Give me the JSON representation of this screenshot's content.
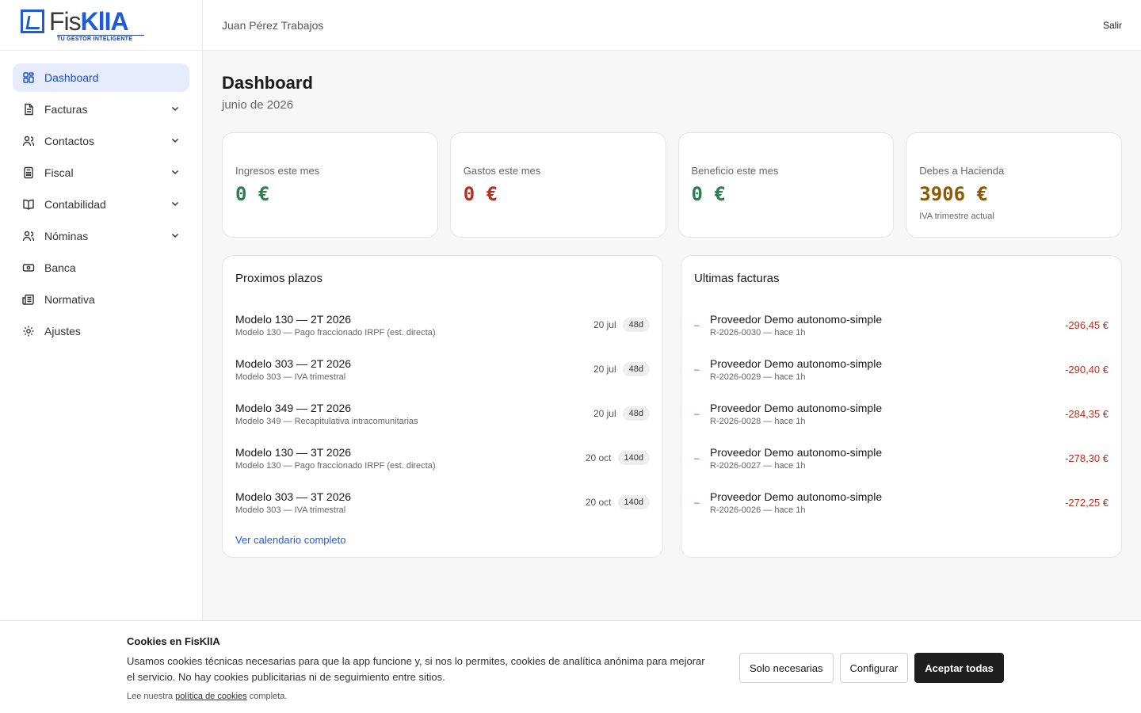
{
  "brand": {
    "logo_fis": "Fis",
    "logo_klia": "KlIA",
    "tagline": "TU GESTOR INTELIGENTE"
  },
  "topbar": {
    "user": "Juan Pérez Trabajos",
    "logout": "Salir"
  },
  "sidebar": {
    "items": [
      {
        "label": "Dashboard",
        "icon": "grid-icon",
        "active": true
      },
      {
        "label": "Facturas",
        "icon": "file-icon",
        "expandable": true
      },
      {
        "label": "Contactos",
        "icon": "users-icon",
        "expandable": true
      },
      {
        "label": "Fiscal",
        "icon": "calculator-icon",
        "expandable": true
      },
      {
        "label": "Contabilidad",
        "icon": "book-icon",
        "expandable": true
      },
      {
        "label": "Nóminas",
        "icon": "users-icon",
        "expandable": true
      },
      {
        "label": "Banca",
        "icon": "banknote-icon"
      },
      {
        "label": "Normativa",
        "icon": "newspaper-icon"
      },
      {
        "label": "Ajustes",
        "icon": "gear-icon"
      }
    ]
  },
  "page": {
    "title": "Dashboard",
    "subtitle": "junio de 2026"
  },
  "kpis": [
    {
      "label": "Ingresos este mes",
      "value": "0 €",
      "color": "#2e7d4f"
    },
    {
      "label": "Gastos este mes",
      "value": "0 €",
      "color": "#b43222"
    },
    {
      "label": "Beneficio este mes",
      "value": "0 €",
      "color": "#2e7d4f"
    },
    {
      "label": "Debes a Hacienda",
      "value": "3906 €",
      "color": "#8a5a00",
      "note": "IVA trimestre actual"
    }
  ],
  "deadlines": {
    "title": "Proximos plazos",
    "items": [
      {
        "title": "Modelo 130 — 2T 2026",
        "sub": "Modelo 130 — Pago fraccionado IRPF (est. directa)",
        "date": "20 jul",
        "days": "48d"
      },
      {
        "title": "Modelo 303 — 2T 2026",
        "sub": "Modelo 303 — IVA trimestral",
        "date": "20 jul",
        "days": "48d"
      },
      {
        "title": "Modelo 349 — 2T 2026",
        "sub": "Modelo 349 — Recapitulativa intracomunitarias",
        "date": "20 jul",
        "days": "48d"
      },
      {
        "title": "Modelo 130 — 3T 2026",
        "sub": "Modelo 130 — Pago fraccionado IRPF (est. directa)",
        "date": "20 oct",
        "days": "140d"
      },
      {
        "title": "Modelo 303 — 3T 2026",
        "sub": "Modelo 303 — IVA trimestral",
        "date": "20 oct",
        "days": "140d"
      }
    ],
    "link": "Ver calendario completo"
  },
  "invoices": {
    "title": "Ultimas facturas",
    "items": [
      {
        "marker": "–",
        "name": "Proveedor Demo autonomo-simple",
        "sub": "R-2026-0030 — hace 1h",
        "amount": "-296,45 €"
      },
      {
        "marker": "–",
        "name": "Proveedor Demo autonomo-simple",
        "sub": "R-2026-0029 — hace 1h",
        "amount": "-290,40 €"
      },
      {
        "marker": "–",
        "name": "Proveedor Demo autonomo-simple",
        "sub": "R-2026-0028 — hace 1h",
        "amount": "-284,35 €"
      },
      {
        "marker": "–",
        "name": "Proveedor Demo autonomo-simple",
        "sub": "R-2026-0027 — hace 1h",
        "amount": "-278,30 €"
      },
      {
        "marker": "–",
        "name": "Proveedor Demo autonomo-simple",
        "sub": "R-2026-0026 — hace 1h",
        "amount": "-272,25 €"
      }
    ]
  },
  "cookies": {
    "title": "Cookies en FisKlIA",
    "body": "Usamos cookies técnicas necesarias para que la app funcione y, si nos lo permites, cookies de analítica anónima para mejorar el servicio. No hay cookies publicitarias ni de seguimiento entre sitios.",
    "foot_pre": "Lee nuestra ",
    "foot_link": "política de cookies",
    "foot_post": " completa.",
    "btn_necessary": "Solo necesarias",
    "btn_configure": "Configurar",
    "btn_accept": "Aceptar todas"
  }
}
